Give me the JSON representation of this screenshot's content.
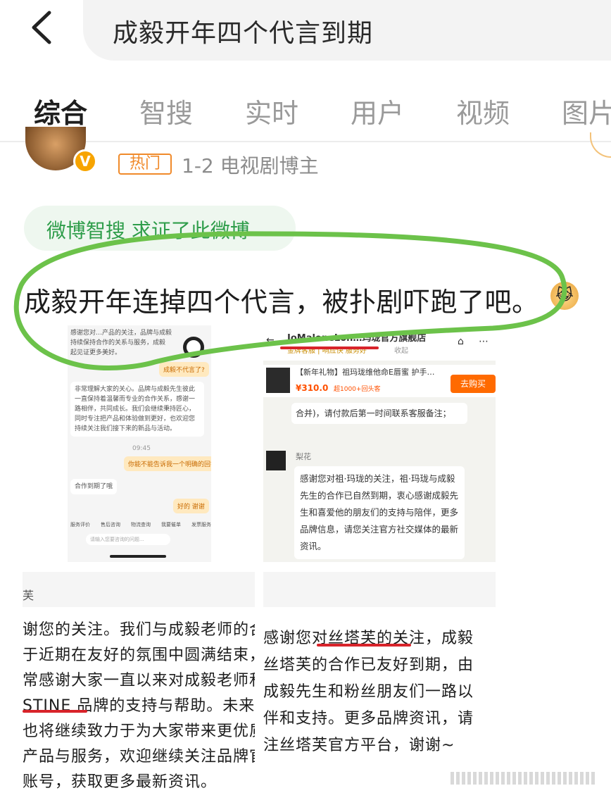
{
  "search": {
    "query": "成毅开年四个代言到期"
  },
  "tabs": [
    {
      "label": "综合"
    },
    {
      "label": "智搜"
    },
    {
      "label": "实时"
    },
    {
      "label": "用户"
    },
    {
      "label": "视频"
    },
    {
      "label": "图片"
    }
  ],
  "post": {
    "hot_badge": "热门",
    "meta": "1-2   电视剧博主",
    "smart_chip": "微博智搜 求证了此微博",
    "text": "成毅开年连掉四个代言，被扑剧吓跑了吧。"
  },
  "shot1": {
    "top_lines": [
      "感谢您对…产品的关注，品牌与成毅",
      "持续保持合作的关系与服务，成毅",
      "起见证更多美好。"
    ],
    "bubble_q1": "成毅不代言了?",
    "answer": "非常理解大家的关心。品牌与成毅先生彼此一直保持着温馨而专业的合作关系，感谢一路相伴，共同成长。我们会继续秉持匠心，同时专注把产品和体验做到更好，也欢迎您持续关注我们接下来的新品与活动。",
    "time": "09:45",
    "bubble_q2": "你能不能告诉我一个明确的回答",
    "answer2": "合作到期了哦",
    "bubble_q3": "好的 谢谢",
    "menu": [
      "服务评价",
      "售后咨询",
      "物流查询",
      "我要催单",
      "发票服务"
    ],
    "input_placeholder": "请输入您要咨询的问题..."
  },
  "shot2": {
    "store": "JoMaloneLon…玛珑官方旗舰店",
    "store_sub": "金牌客服 | 响应快 服务好",
    "collapse": "收起",
    "product": "【新年礼物】祖玛珑维他命E唇蜜 护手…",
    "price": "¥310.0",
    "sold": "超1000+回头客",
    "buy": "去购买",
    "partial": "合并)，请付款后第一时间联系客服备注；",
    "agent": "梨花",
    "reply": "感谢您对祖·玛珑的关注，祖·玛珑与成毅先生的合作已自然到期，衷心感谢成毅先生和喜爱他的朋友们的支持与陪伴，更多品牌信息，请您关注官方社交媒体的最新资讯。"
  },
  "shot3": {
    "header": "芙",
    "lines": [
      "谢您的关注。我们与成毅老师的合",
      "于近期在友好的氛围中圆满结束，",
      "常感谢大家一直以来对成毅老师和",
      "STINE 品牌的支持与帮助。未来我",
      "也将继续致力于为大家带来更优质",
      "产品与服务，欢迎继续关注品牌官",
      "账号，获取更多最新资讯。"
    ]
  },
  "shot4": {
    "lines": [
      "感谢您对丝塔芙的关注，成毅",
      "丝塔芙的合作已友好到期，由",
      "成毅先生和粉丝朋友们一路以",
      "伴和支持。更多品牌资讯，请",
      "注丝塔芙官方平台，谢谢~"
    ]
  },
  "colors": {
    "accent": "#ff8200",
    "green_annotation": "#6cc24a",
    "red_mark": "#d8232a"
  }
}
